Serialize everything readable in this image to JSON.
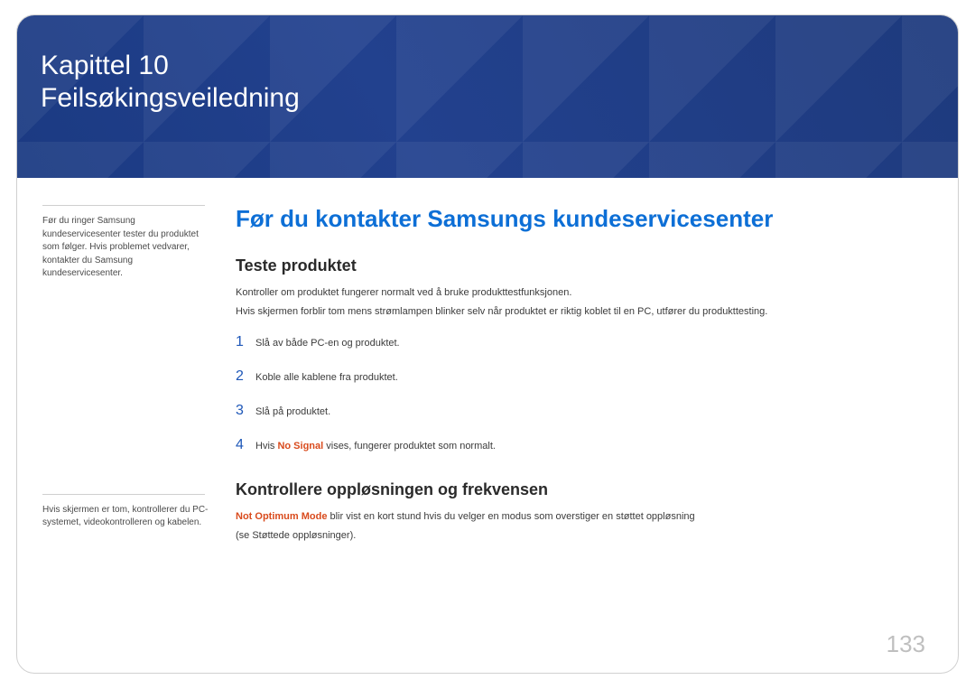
{
  "hero": {
    "line1": "Kapittel 10",
    "line2": "Feilsøkingsveiledning"
  },
  "sidebar": {
    "note1": "Før du ringer Samsung kundeservicesenter tester du produktet som følger. Hvis problemet vedvarer, kontakter du Samsung kundeservicesenter.",
    "note2": "Hvis skjermen er tom, kontrollerer du PC-systemet, videokontrolleren og kabelen."
  },
  "main": {
    "heading": "Før du kontakter Samsungs kundeservicesenter",
    "section1": {
      "title": "Teste produktet",
      "p1": "Kontroller om produktet fungerer normalt ved å bruke produkttestfunksjonen.",
      "p2": "Hvis skjermen forblir tom mens strømlampen blinker selv når produktet er riktig koblet til en PC, utfører du produkttesting.",
      "steps": [
        {
          "num": "1",
          "text": "Slå av både PC-en og produktet."
        },
        {
          "num": "2",
          "text": "Koble alle kablene fra produktet."
        },
        {
          "num": "3",
          "text": "Slå på produktet."
        },
        {
          "num": "4",
          "prefix": "Hvis ",
          "highlight": "No Signal",
          "suffix": " vises, fungerer produktet som normalt."
        }
      ]
    },
    "section2": {
      "title": "Kontrollere oppløsningen og frekvensen",
      "p1_highlight": "Not Optimum Mode",
      "p1_rest": " blir vist en kort stund hvis du velger en modus som overstiger en støttet oppløsning",
      "p2": "(se Støttede oppløsninger)."
    }
  },
  "page_number": "133"
}
